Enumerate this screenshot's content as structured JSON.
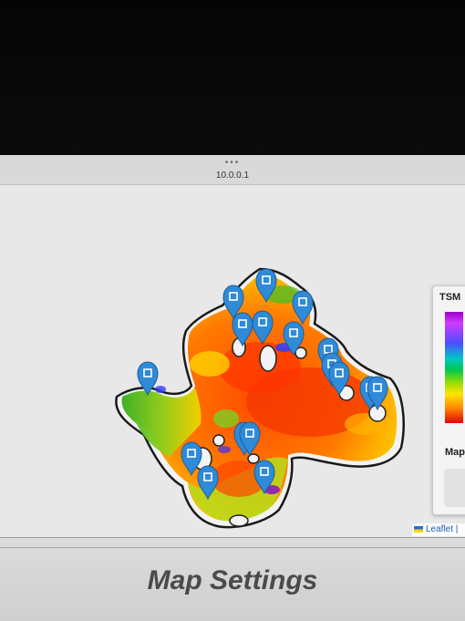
{
  "browser": {
    "menu_dots": "•••",
    "url": "10.0.0.1"
  },
  "legend": {
    "title": "TSM",
    "subtitle": "Map",
    "colors": [
      "#9c00c8",
      "#d03cff",
      "#4d4dff",
      "#00c8c8",
      "#00c850",
      "#9ade00",
      "#ffe400",
      "#ff8c00",
      "#e80000"
    ]
  },
  "map": {
    "attribution": "Leaflet",
    "marker_icon": "map-pin-icon",
    "marker_count": 17
  },
  "settings": {
    "title": "Map Settings"
  }
}
